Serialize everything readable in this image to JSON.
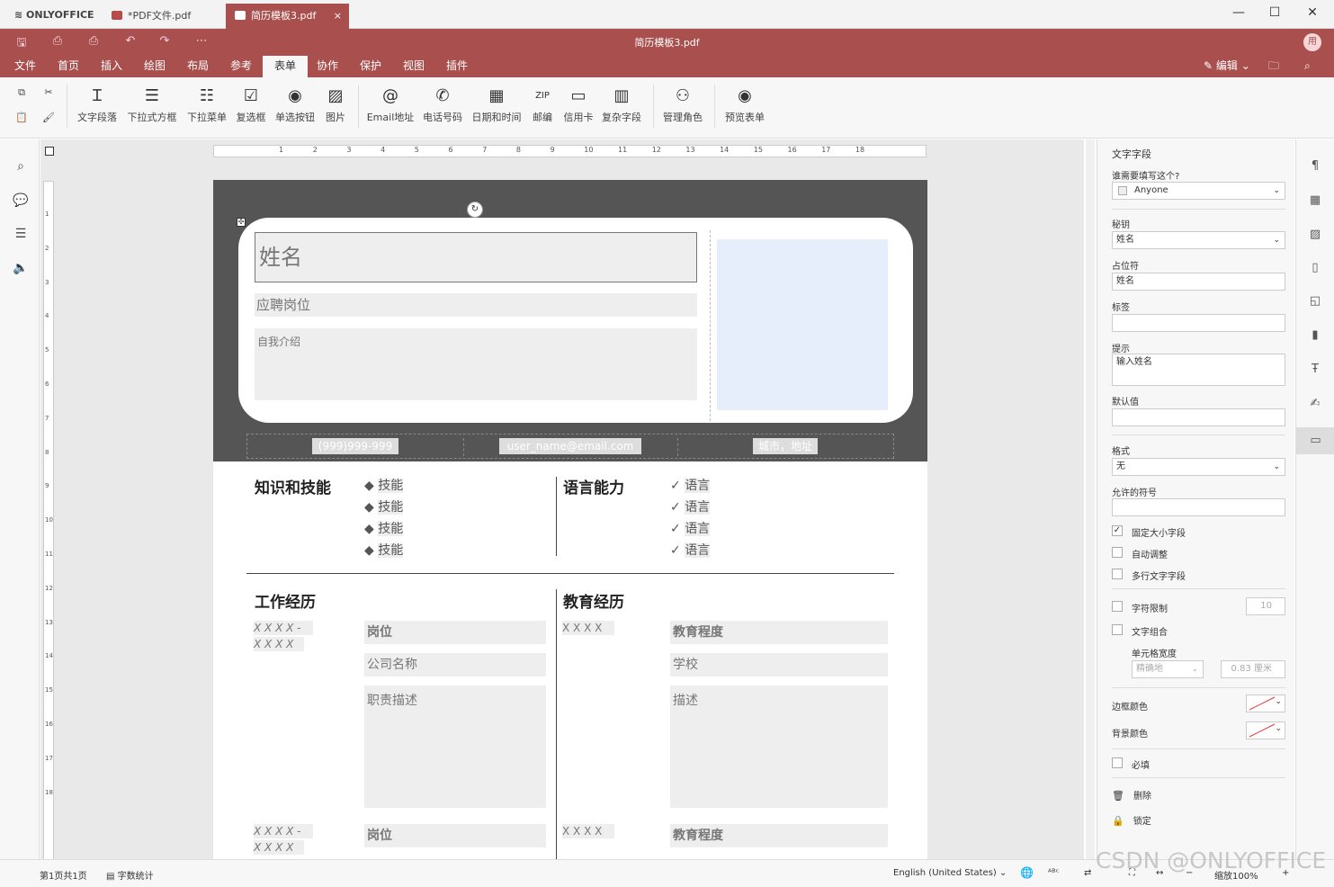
{
  "window": {
    "app_name": "ONLYOFFICE",
    "tabs": [
      {
        "label": "*PDF文件.pdf"
      },
      {
        "label": "简历模板3.pdf"
      }
    ],
    "close_tab": "×",
    "minimize": "—",
    "maximize": "☐",
    "close": "✕"
  },
  "header": {
    "doc_title": "简历模板3.pdf",
    "avatar": "用",
    "edit_label": "编辑"
  },
  "menus": [
    "文件",
    "首页",
    "插入",
    "绘图",
    "布局",
    "参考",
    "表单",
    "协作",
    "保护",
    "视图",
    "插件"
  ],
  "toolbar": {
    "items": [
      "文字段落",
      "下拉式方框",
      "下拉菜单",
      "复选框",
      "单选按钮",
      "图片",
      "Email地址",
      "电话号码",
      "日期和时间",
      "邮编",
      "信用卡",
      "复杂字段",
      "管理角色",
      "预览表单"
    ],
    "icons": [
      "Ɪ",
      "☰",
      "☷",
      "☑",
      "◉",
      "▨",
      "@",
      "✆",
      "▦",
      "ZIP",
      "▭",
      "▥",
      "⚇",
      "◉"
    ]
  },
  "ruler": {
    "ticks": [
      "1",
      "2",
      "3",
      "4",
      "5",
      "6",
      "7",
      "8",
      "9",
      "10",
      "11",
      "12",
      "13",
      "14",
      "15",
      "16",
      "17",
      "18"
    ]
  },
  "vruler": {
    "ticks": [
      "1",
      "2",
      "3",
      "4",
      "5",
      "6",
      "7",
      "8",
      "9",
      "10",
      "11",
      "12",
      "13",
      "14",
      "15",
      "16",
      "17",
      "18"
    ]
  },
  "resume": {
    "name": "姓名",
    "position": "应聘岗位",
    "intro": "自我介绍",
    "phone": "(999)999-999",
    "email": "user_name@email.com",
    "address": "城市，地址",
    "skills_title": "知识和技能",
    "skills": [
      "技能",
      "技能",
      "技能",
      "技能"
    ],
    "lang_title": "语言能力",
    "langs": [
      "语言",
      "语言",
      "语言",
      "语言"
    ],
    "work_title": "工作经历",
    "edu_title": "教育经历",
    "date1": "X X X X -",
    "date2": "X X X X",
    "job": "岗位",
    "company": "公司名称",
    "duty": "职责描述",
    "edu_date": "X X X X",
    "degree": "教育程度",
    "school": "学校",
    "desc": "描述"
  },
  "panel": {
    "title": "文字字段",
    "who_label": "谁需要填写这个?",
    "who_value": "Anyone",
    "key_label": "秘钥",
    "key_value": "姓名",
    "placeholder_label": "占位符",
    "placeholder_value": "姓名",
    "tag_label": "标签",
    "tip_label": "提示",
    "tip_value": "输入姓名",
    "default_label": "默认值",
    "format_label": "格式",
    "format_value": "无",
    "allowed_label": "允许的符号",
    "fixed_label": "固定大小字段",
    "autofit_label": "自动调整",
    "multiline_label": "多行文字字段",
    "charlimit_label": "字符限制",
    "charlimit_value": "10",
    "comb_label": "文字组合",
    "cellwidth_label": "单元格宽度",
    "cellwidth_mode": "精确地",
    "cellwidth_value": "0.83 厘米",
    "border_label": "边框颜色",
    "bg_label": "背景颜色",
    "required_label": "必填",
    "delete_label": "删除",
    "lock_label": "锁定"
  },
  "status": {
    "page": "第1页共1页",
    "wordcount": "字数统计",
    "lang": "English (United States)",
    "zoom": "缩放100%"
  },
  "watermark": "CSDN @ONLYOFFICE"
}
